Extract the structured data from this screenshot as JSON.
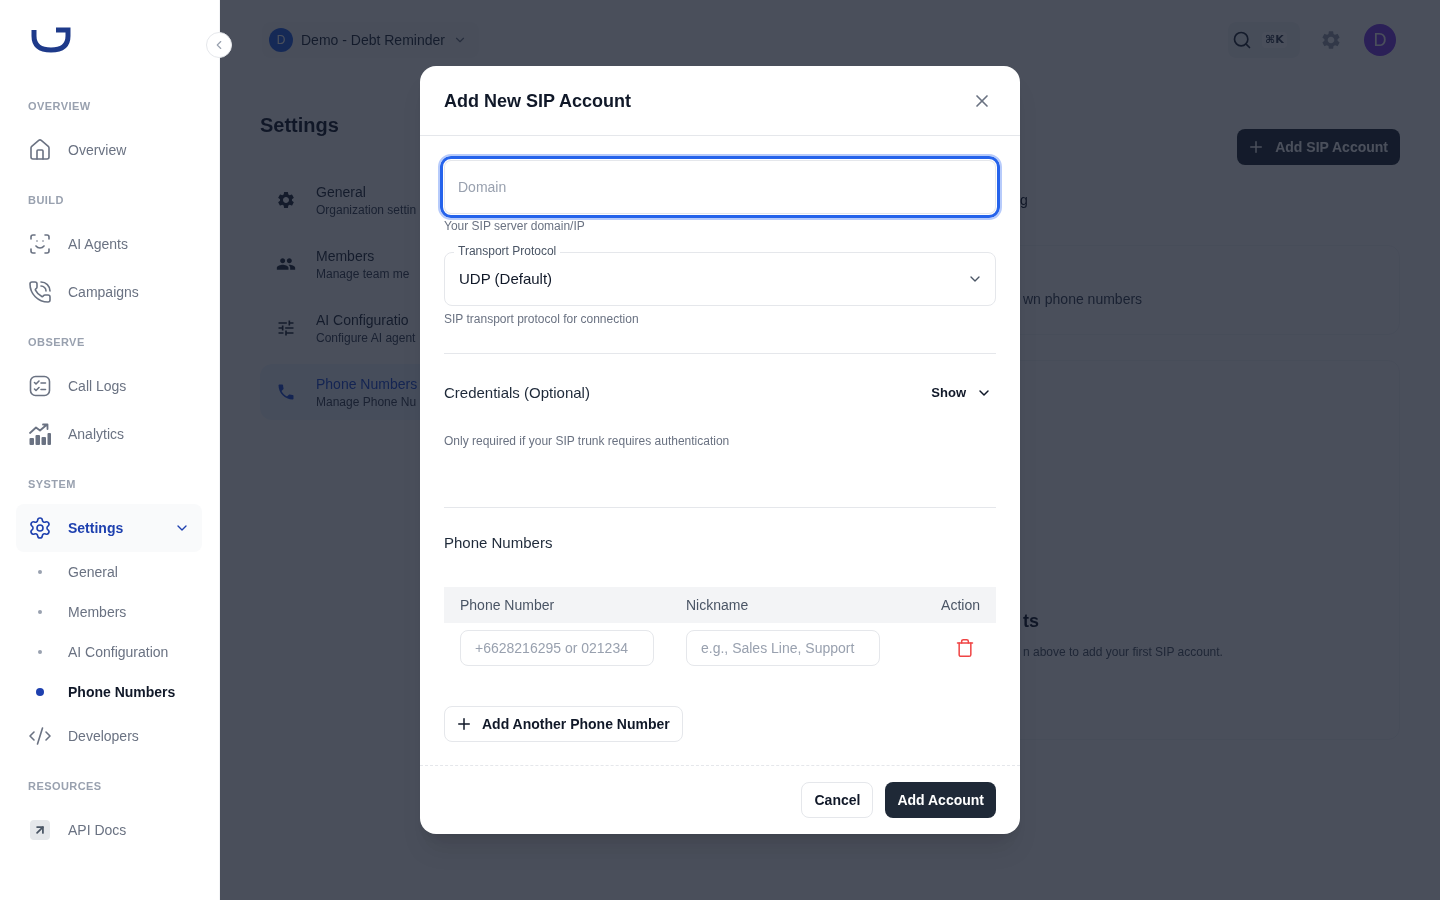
{
  "sidebar": {
    "sections": [
      {
        "title": "OVERVIEW",
        "items": [
          {
            "label": "Overview",
            "selected": false
          }
        ]
      },
      {
        "title": "BUILD",
        "items": [
          {
            "label": "AI Agents",
            "selected": false
          },
          {
            "label": "Campaigns",
            "selected": false
          }
        ]
      },
      {
        "title": "OBSERVE",
        "items": [
          {
            "label": "Call Logs",
            "selected": false
          },
          {
            "label": "Analytics",
            "selected": false
          }
        ]
      },
      {
        "title": "SYSTEM",
        "items": [
          {
            "label": "Settings",
            "selected": true,
            "expanded": true,
            "children": [
              {
                "label": "General",
                "selected": false
              },
              {
                "label": "Members",
                "selected": false
              },
              {
                "label": "AI Configuration",
                "selected": false
              },
              {
                "label": "Phone Numbers",
                "selected": true
              }
            ]
          },
          {
            "label": "Developers",
            "selected": false
          }
        ]
      },
      {
        "title": "RESOURCES",
        "items": [
          {
            "label": "API Docs",
            "selected": false
          }
        ]
      }
    ]
  },
  "topbar": {
    "workspace": {
      "initial": "D",
      "name": "Demo - Debt Reminder"
    },
    "search_shortcut": "⌘K",
    "user_initial": "D"
  },
  "page": {
    "title": "Settings",
    "settings_nav": [
      {
        "title": "General",
        "subtitle": "Organization settin",
        "selected": false
      },
      {
        "title": "Members",
        "subtitle": "Manage team me",
        "selected": false
      },
      {
        "title": "AI Configuratio",
        "subtitle": "Configure AI agent",
        "selected": false
      },
      {
        "title": "Phone Numbers",
        "subtitle": "Manage Phone Nu",
        "selected": true
      }
    ],
    "add_button": "Add SIP Account",
    "header_fragment": "g",
    "info_card": {
      "text": "wn phone numbers"
    },
    "empty_state": {
      "title": "ts",
      "text": "n above to add your first SIP account."
    }
  },
  "dialog": {
    "title": "Add New SIP Account",
    "domain_field": {
      "placeholder": "Domain",
      "focused": true,
      "hint": "Your SIP server domain/IP"
    },
    "transport_field": {
      "label": "Transport Protocol",
      "value": "UDP (Default)",
      "hint": "SIP transport protocol for connection"
    },
    "credentials": {
      "title": "Credentials (Optional)",
      "toggle": "Show",
      "expanded": false,
      "hint": "Only required if your SIP trunk requires authentication"
    },
    "phone_numbers": {
      "title": "Phone Numbers",
      "columns": [
        "Phone Number",
        "Nickname",
        "Action"
      ],
      "rows": [
        {
          "phone_placeholder": "+6628216295 or 021234",
          "nickname_placeholder": "e.g., Sales Line, Support"
        }
      ],
      "add_button": "Add Another Phone Number"
    },
    "buttons": [
      {
        "label": "Cancel",
        "kind": "secondary"
      },
      {
        "label": "Add Account",
        "kind": "primary"
      }
    ]
  }
}
